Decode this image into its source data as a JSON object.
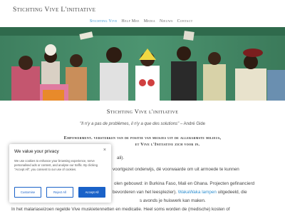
{
  "header": {
    "site_title": "Stichting Vive L'initiative",
    "nav": [
      {
        "label": "Stichting Vive",
        "active": true
      },
      {
        "label": "Help Mee",
        "active": false
      },
      {
        "label": "Media",
        "active": false
      },
      {
        "label": "Nieuws",
        "active": false
      },
      {
        "label": "Contact",
        "active": false
      }
    ]
  },
  "main": {
    "heading": "Stichting Vive l'initiative",
    "quote": "\"Il n'y a pas de problèmes, il n'y a que des solutions\"",
    "quote_author": " – André Gide",
    "mission_line1": "Empowerment. versterken van de positie van meisjes uit de allerarmste milieus,",
    "mission_line2": "et Vive l'Initiative zich voor in.",
    "para1": "ali).",
    "para2": "voortgezet onderwijs, dé voorwaarde om uit armoede te kunnen",
    "para3": "olen gebouwd: in Burkina Faso, Mali en Ghana. Projecten gefinancierd",
    "para4_before": "bevorderen van het leesplezier). ",
    "para4_link": "WakaWaka lampen",
    "para4_after": " uitgedeeld, die",
    "para5": "s avonds je huiswerk kan maken.",
    "para6": "In het malariaseizoen regelde Vive muskietennetten en medicatie. Heel soms worden de (medische) kosten of"
  },
  "cookie": {
    "title": "We value your privacy",
    "close": "×",
    "text": "We use cookies to enhance your browsing experience, serve personalised ads or content, and analyse our traffic. By clicking \"Accept All\", you consent to our use of cookies.",
    "customise": "Customise",
    "reject": "Reject All",
    "accept": "Accept All"
  },
  "colors": {
    "accent": "#2f8fcf",
    "cookie_button": "#1a62c8"
  }
}
